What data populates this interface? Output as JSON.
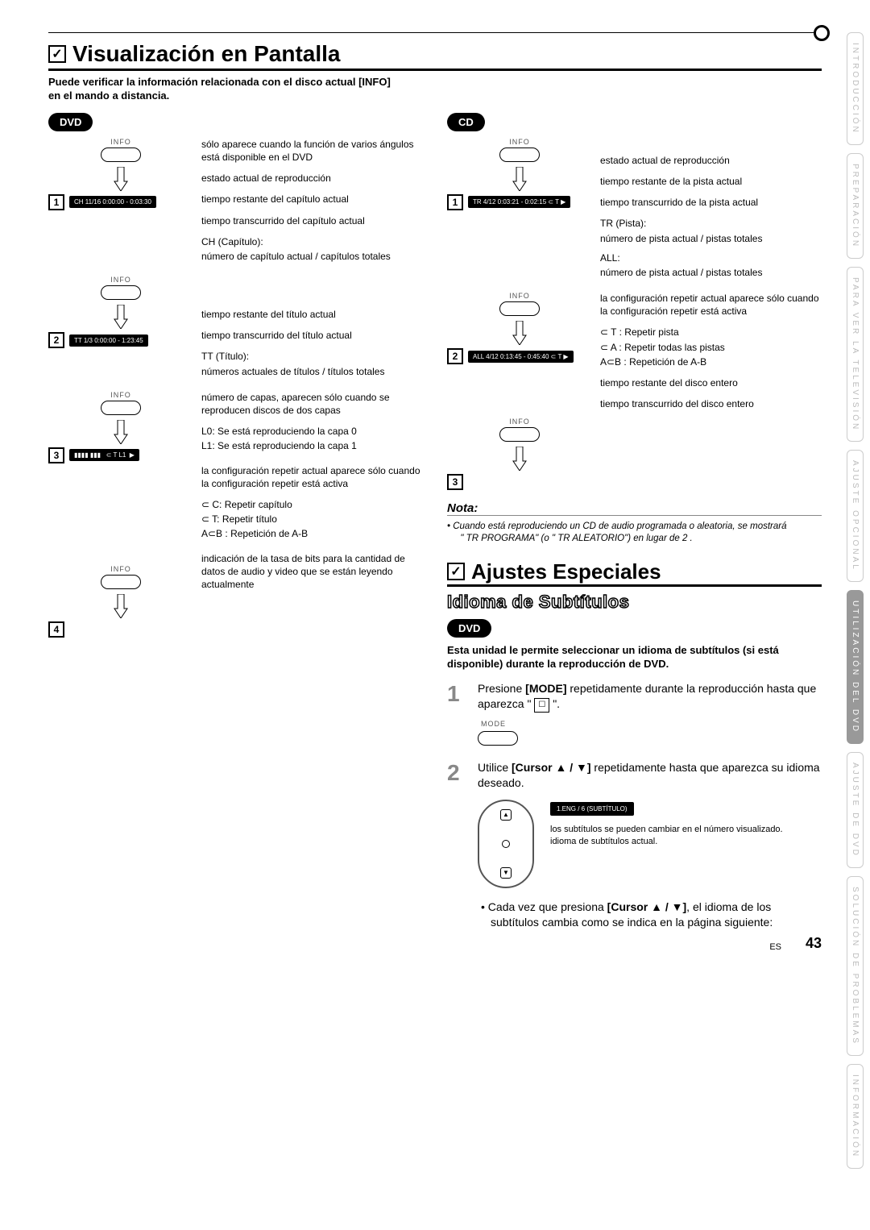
{
  "header": {
    "title": "Visualización en Pantalla",
    "intro": "Puede verificar la información relacionada con el disco actual [INFO] en el mando a distancia."
  },
  "dvd": {
    "label": "DVD",
    "angle": "sólo aparece cuando la función de varios ángulos está disponible en el DVD",
    "row1_disp": "CH 11/16  0:00:00 - 0:03:30",
    "estado": "estado actual de reproducción",
    "trem": "tiempo restante del capítulo actual",
    "telap": "tiempo transcurrido del capítulo actual",
    "ch_head": "CH (Capítulo):",
    "ch_body": "número de capítulo actual / capítulos totales",
    "row2_disp": "TT 1/3   0:00:00 - 1:23:45",
    "t_rem": "tiempo restante del título actual",
    "t_elap": "tiempo transcurrido del título actual",
    "tt_head": "TT (Título):",
    "tt_body": "números actuales de títulos / títulos totales",
    "row3_layers": "número de capas, aparecen sólo cuando se reproducen discos de dos capas",
    "l0": "L0:   Se está reproduciendo la capa 0",
    "l1": "L1:   Se está reproduciendo la capa 1",
    "repeat_head": "la configuración repetir actual aparece sólo cuando la configuración repetir está activa",
    "rc": "⊂ C:    Repetir capítulo",
    "rt": "⊂ T:     Repetir título",
    "rab": "A⊂B :  Repetición de A-B",
    "bitrate": "indicación de la tasa de bits para la cantidad de datos de audio y video que se están leyendo actualmente"
  },
  "cd": {
    "label": "CD",
    "row1_disp": "TR 4/12  0:03:21 - 0:02:15  ⊂ T  ▶",
    "estado": "estado actual de reproducción",
    "trem": "tiempo restante de la pista actual",
    "telap": "tiempo transcurrido de la pista actual",
    "tr_head": "TR (Pista):",
    "tr_body": "número de pista actual / pistas totales",
    "all_head": "ALL:",
    "all_body": "número de pista actual / pistas totales",
    "row2_disp": "ALL 4/12  0:13:45 - 0:45:40  ⊂ T  ▶",
    "repeat_head": "la configuración repetir actual aparece sólo cuando la configuración repetir está activa",
    "rt": "⊂ T :    Repetir pista",
    "ra": "⊂ A :   Repetir todas las pistas",
    "rab": "A⊂B :  Repetición de A-B",
    "d_rem": "tiempo restante del disco entero",
    "d_elap": "tiempo transcurrido del disco entero"
  },
  "note": {
    "heading": "Nota:",
    "body1": "Cuando está reproduciendo un CD de audio programada o aleatoria, se mostrará",
    "body2": "\" TR PROGRAMA\" (o \" TR ALEATORIO\") en lugar de 2 ."
  },
  "ajustes": {
    "title": "Ajustes Especiales",
    "subtitle": "Idioma de Subtítulos",
    "pill": "DVD",
    "body": "Esta unidad le permite seleccionar un idioma de subtítulos (si está disponible) durante la reproducción de DVD.",
    "step1": "Presione [MODE] repetidamente durante la reproducción hasta que aparezca \"        \".",
    "modelabel": "MODE",
    "step2": "Utilice [Cursor ▲ / ▼] repetidamente hasta que aparezca su idioma deseado.",
    "subdisp": "1.ENG / 6   (SUBTÍTULO)",
    "sublabel1": "los subtítulos se pueden cambiar en el número visualizado.",
    "sublabel2": "idioma de subtítulos actual.",
    "bullet": "Cada vez que presiona [Cursor ▲ / ▼], el idioma de los subtítulos cambia como se indica en la página siguiente:"
  },
  "sidebar": {
    "s1": "INTRODUCCIÓN",
    "s2": "PREPARACIÓN",
    "s3": "PARA VER LA TELEVISIÓN",
    "s4": "AJUSTE OPCIONAL",
    "s5": "UTILIZACIÓN DEL DVD",
    "s6": "AJUSTE DE DVD",
    "s7": "SOLUCIÓN DE PROBLEMAS",
    "s8": "INFORMACIÓN"
  },
  "misc": {
    "info": "INFO",
    "pagenum": "43",
    "lang": "ES"
  }
}
